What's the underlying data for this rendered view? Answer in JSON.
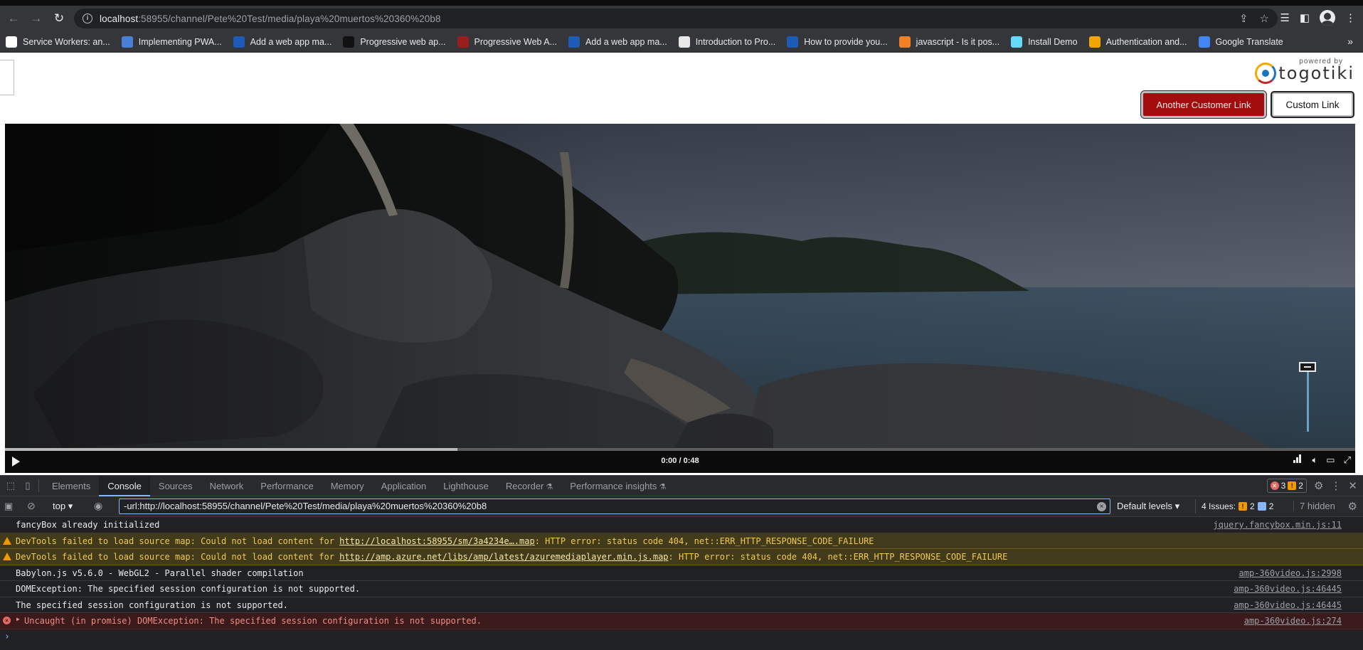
{
  "browser": {
    "url_host": "localhost",
    "url_rest": ":58955/channel/Pete%20Test/media/playa%20muertos%20360%20b8",
    "bookmarks": [
      {
        "label": "Service Workers: an...",
        "icon": "bookmark-favicon",
        "color": "#ffffff"
      },
      {
        "label": "Implementing PWA...",
        "icon": "bookmark-favicon",
        "color": "#4a7fd6"
      },
      {
        "label": "Add a web app ma...",
        "icon": "bookmark-favicon",
        "color": "#1e5bb8"
      },
      {
        "label": "Progressive web ap...",
        "icon": "bookmark-favicon",
        "color": "#111111"
      },
      {
        "label": "Progressive Web A...",
        "icon": "bookmark-favicon",
        "color": "#9b1c1c"
      },
      {
        "label": "Add a web app ma...",
        "icon": "bookmark-favicon",
        "color": "#1e5bb8"
      },
      {
        "label": "Introduction to Pro...",
        "icon": "bookmark-favicon",
        "color": "#e8e8e8"
      },
      {
        "label": "How to provide you...",
        "icon": "bookmark-favicon",
        "color": "#1e5bb8"
      },
      {
        "label": "javascript - Is it pos...",
        "icon": "bookmark-favicon",
        "color": "#f48024"
      },
      {
        "label": "Install Demo",
        "icon": "bookmark-favicon",
        "color": "#61dafb"
      },
      {
        "label": "Authentication and...",
        "icon": "bookmark-favicon",
        "color": "#f0a500"
      },
      {
        "label": "Google Translate",
        "icon": "bookmark-favicon",
        "color": "#4285f4"
      }
    ]
  },
  "page": {
    "logo_powered": "powered by",
    "logo_brand": "togotiki",
    "btn_customer": "Another Customer Link",
    "btn_custom": "Custom Link"
  },
  "player": {
    "time": "0:00 / 0:48",
    "progress": 0.335,
    "state": "paused"
  },
  "devtools": {
    "tabs": [
      "Elements",
      "Console",
      "Sources",
      "Network",
      "Performance",
      "Memory",
      "Application",
      "Lighthouse",
      "Recorder",
      "Performance insights"
    ],
    "active_tab": "Console",
    "errors_count": "3",
    "warnings_count": "2",
    "context": "top",
    "filter_text": "-url:http://localhost:58955/channel/Pete%20Test/media/playa%20muertos%20360%20b8",
    "levels": "Default levels",
    "issues_label": "4 Issues:",
    "issues_warn": "2",
    "issues_info": "2",
    "hidden": "7 hidden",
    "messages": [
      {
        "type": "log",
        "text": "fancyBox already initialized",
        "source": "jquery.fancybox.min.js:11"
      },
      {
        "type": "warn",
        "pre": "DevTools failed to load source map: Could not load content for ",
        "link": "http://localhost:58955/sm/3a4234e….map",
        "post": ": HTTP error: status code 404, net::ERR_HTTP_RESPONSE_CODE_FAILURE",
        "source": ""
      },
      {
        "type": "warn",
        "pre": "DevTools failed to load source map: Could not load content for ",
        "link": "http://amp.azure.net/libs/amp/latest/azuremediaplayer.min.js.map",
        "post": ": HTTP error: status code 404, net::ERR_HTTP_RESPONSE_CODE_FAILURE",
        "source": ""
      },
      {
        "type": "log",
        "text": "Babylon.js v5.6.0 - WebGL2 - Parallel shader compilation",
        "source": "amp-360video.js:2998"
      },
      {
        "type": "log",
        "text": "DOMException: The specified session configuration is not supported.",
        "source": "amp-360video.js:46445"
      },
      {
        "type": "log",
        "text": "The specified session configuration is not supported.",
        "source": "amp-360video.js:46445"
      },
      {
        "type": "error",
        "text": "Uncaught (in promise) DOMException: The specified session configuration is not supported.",
        "source": "amp-360video.js:274"
      }
    ]
  }
}
